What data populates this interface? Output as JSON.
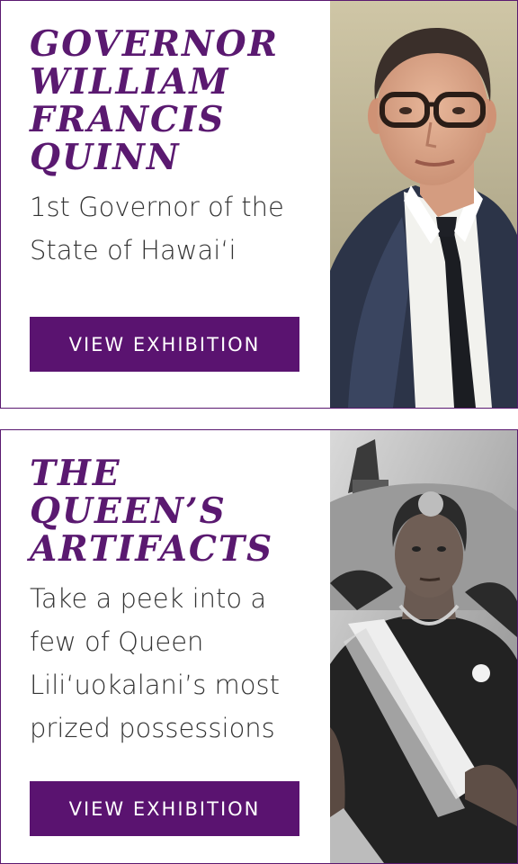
{
  "cards": [
    {
      "title_lines": [
        "GOVERNOR",
        "WILLIAM",
        "FRANCIS",
        "QUINN"
      ],
      "description_lines": [
        "1st Governor of the",
        "State of Hawai‘i"
      ],
      "button_label": "VIEW EXHIBITION"
    },
    {
      "title_lines": [
        "THE",
        "QUEEN’S",
        "ARTIFACTS"
      ],
      "description_lines": [
        "Take a peek into a",
        "few of Queen",
        "Lili‘uokalani’s most",
        "prized possessions"
      ],
      "button_label": "VIEW EXHIBITION"
    }
  ],
  "colors": {
    "brand_purple": "#5a1970",
    "button_purple": "#5a1370",
    "body_text": "#333333"
  }
}
